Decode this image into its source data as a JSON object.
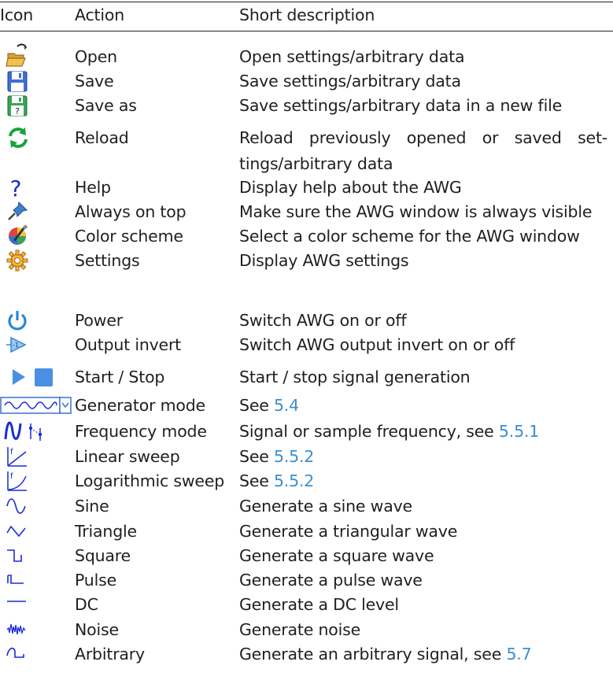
{
  "header": {
    "icon": "Icon",
    "action": "Action",
    "description": "Short description"
  },
  "rows": [
    {
      "icon": "open-folder-icon",
      "action": "Open",
      "description": "Open settings/arbitrary data"
    },
    {
      "icon": "save-icon",
      "action": "Save",
      "description": "Save settings/arbitrary data"
    },
    {
      "icon": "save-as-icon",
      "action": "Save as",
      "description": "Save settings/arbitrary data in a new file"
    },
    {
      "icon": "reload-icon",
      "action": "Reload",
      "description": "Reload previously opened or saved set-tings/arbitrary data"
    },
    {
      "icon": "help-icon",
      "action": "Help",
      "description": "Display help about the AWG"
    },
    {
      "icon": "pin-icon",
      "action": "Always on top",
      "description": "Make sure the AWG window is always visible"
    },
    {
      "icon": "color-picker-icon",
      "action": "Color scheme",
      "description": "Select a color scheme for the AWG window"
    },
    {
      "icon": "gear-icon",
      "action": "Settings",
      "description": "Display AWG settings"
    },
    {
      "icon": "power-icon",
      "action": "Power",
      "description": "Switch AWG on or off"
    },
    {
      "icon": "output-invert-icon",
      "action": "Output invert",
      "description": "Switch AWG output invert on or off"
    },
    {
      "icon": "play-stop-icon",
      "action": "Start / Stop",
      "description": "Start / stop signal generation"
    },
    {
      "icon": "generator-mode-dropdown-icon",
      "action": "Generator mode",
      "description": "See ",
      "ref": "5.4"
    },
    {
      "icon": "frequency-mode-icon",
      "action": "Frequency mode",
      "description": "Signal or sample frequency, see ",
      "ref": "5.5.1"
    },
    {
      "icon": "linear-sweep-icon",
      "action": "Linear sweep",
      "description": "See ",
      "ref": "5.5.2"
    },
    {
      "icon": "log-sweep-icon",
      "action": "Logarithmic sweep",
      "description": "See ",
      "ref": "5.5.2"
    },
    {
      "icon": "sine-wave-icon",
      "action": "Sine",
      "description": "Generate a sine wave"
    },
    {
      "icon": "triangle-wave-icon",
      "action": "Triangle",
      "description": "Generate a triangular wave"
    },
    {
      "icon": "square-wave-icon",
      "action": "Square",
      "description": "Generate a square wave"
    },
    {
      "icon": "pulse-wave-icon",
      "action": "Pulse",
      "description": "Generate a pulse wave"
    },
    {
      "icon": "dc-level-icon",
      "action": "DC",
      "description": "Generate a DC level"
    },
    {
      "icon": "noise-icon",
      "action": "Noise",
      "description": "Generate noise"
    },
    {
      "icon": "arbitrary-wave-icon",
      "action": "Arbitrary",
      "description": "Generate an arbitrary signal, see ",
      "ref": "5.7"
    }
  ]
}
